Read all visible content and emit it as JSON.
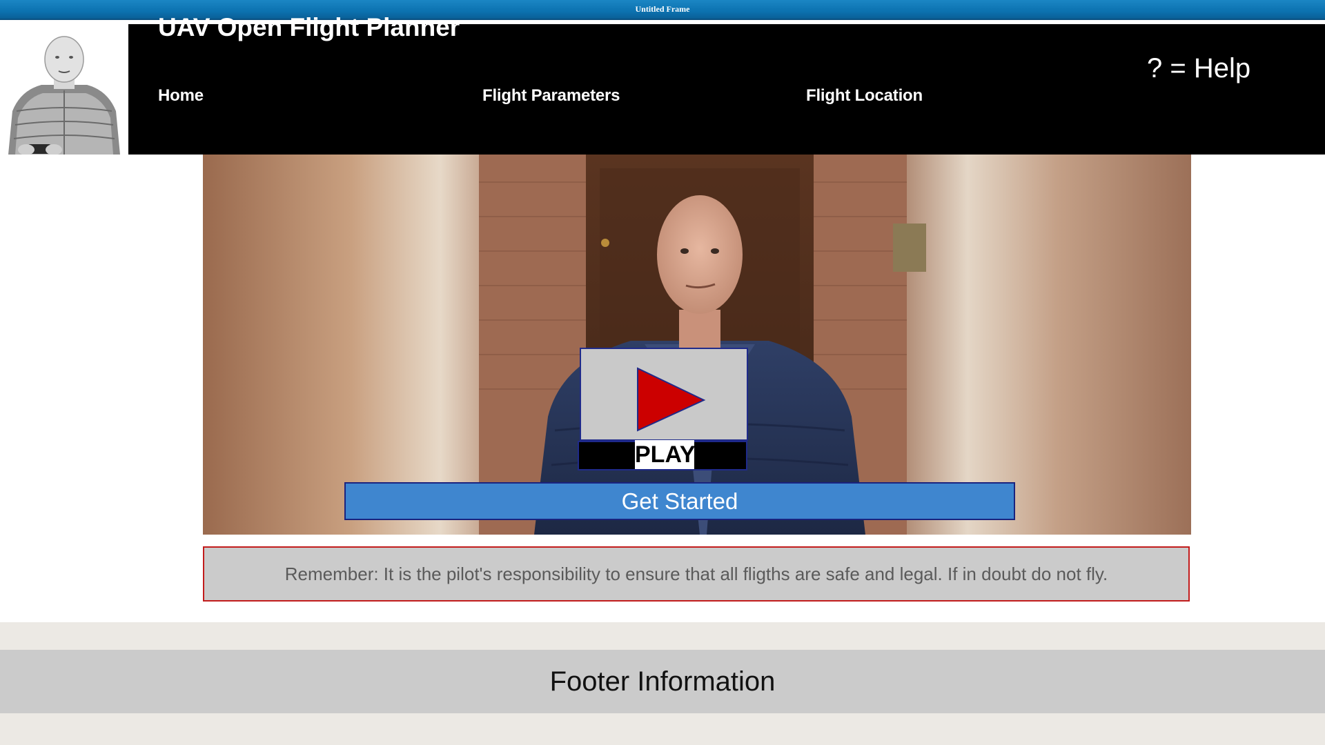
{
  "window": {
    "title": "Untitled Frame"
  },
  "header": {
    "site_title": "UAV Open Flight Planner",
    "nav": [
      {
        "label": "Home"
      },
      {
        "label": "Flight Parameters"
      },
      {
        "label": "Flight Location"
      }
    ],
    "help_label": "? = Help"
  },
  "hero": {
    "play_label": "PLAY",
    "get_started_label": "Get Started"
  },
  "notice": {
    "text": "Remember: It is the pilot's responsibility to ensure that all fligths are safe and legal.  If in doubt do not fly."
  },
  "footer": {
    "text": "Footer Information"
  },
  "colors": {
    "header_bg": "#000000",
    "accent_button": "#3f86cf",
    "notice_border": "#c21b1b",
    "play_triangle": "#cc0000",
    "footer_bg": "#cbcbcb"
  },
  "icons": {
    "play": "play-triangle-icon"
  }
}
